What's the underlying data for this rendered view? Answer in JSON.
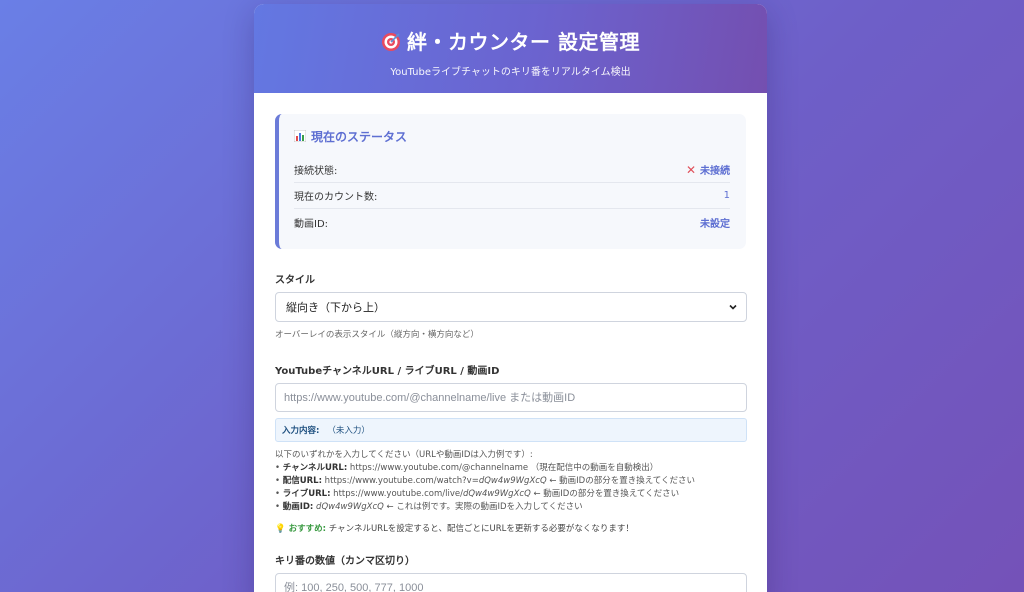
{
  "header": {
    "title": "絆・カウンター 設定管理",
    "subtitle": "YouTubeライブチャットのキリ番をリアルタイム検出"
  },
  "status": {
    "title": "現在のステータス",
    "rows": [
      {
        "label": "接続状態:",
        "value": "未接続"
      },
      {
        "label": "現在のカウント数:",
        "value": "1"
      },
      {
        "label": "動画ID:",
        "value": "未設定"
      }
    ]
  },
  "style_field": {
    "label": "スタイル",
    "selected": "縦向き（下から上）",
    "help": "オーバーレイの表示スタイル（縦方向・横方向など）"
  },
  "url_field": {
    "label": "YouTubeチャンネルURL / ライブURL / 動画ID",
    "value": "",
    "placeholder": "https://www.youtube.com/@channelname/live または動画ID",
    "preview_label": "入力内容:",
    "preview_value": "（未入力）",
    "desc_intro": "以下のいずれかを入力してください（URLや動画IDは入力例です）:",
    "desc_items": [
      {
        "label": "チャンネルURL:",
        "text": " https://www.youtube.com/@channelname （現在配信中の動画を自動検出）"
      },
      {
        "label": "配信URL:",
        "text": " https://www.youtube.com/watch?v=",
        "italic": "dQw4w9WgXcQ",
        "tail": " ← 動画IDの部分を置き換えてください"
      },
      {
        "label": "ライブURL:",
        "text": " https://www.youtube.com/live/",
        "italic": "dQw4w9WgXcQ",
        "tail": " ← 動画IDの部分を置き換えてください"
      },
      {
        "label": "動画ID:",
        "text": " ",
        "italic": "dQw4w9WgXcQ",
        "tail": " ← これは例です。実際の動画IDを入力してください"
      }
    ],
    "tip_label": "おすすめ:",
    "tip_text": " チャンネルURLを設定すると、配信ごとにURLを更新する必要がなくなります！"
  },
  "kiri_field": {
    "label": "キリ番の数値（カンマ区切り）",
    "value": "",
    "placeholder": "例: 100, 250, 500, 777, 1000"
  },
  "colors": {
    "accent": "#5e6fd2",
    "error": "#e0505a",
    "success": "#3a9a42"
  }
}
